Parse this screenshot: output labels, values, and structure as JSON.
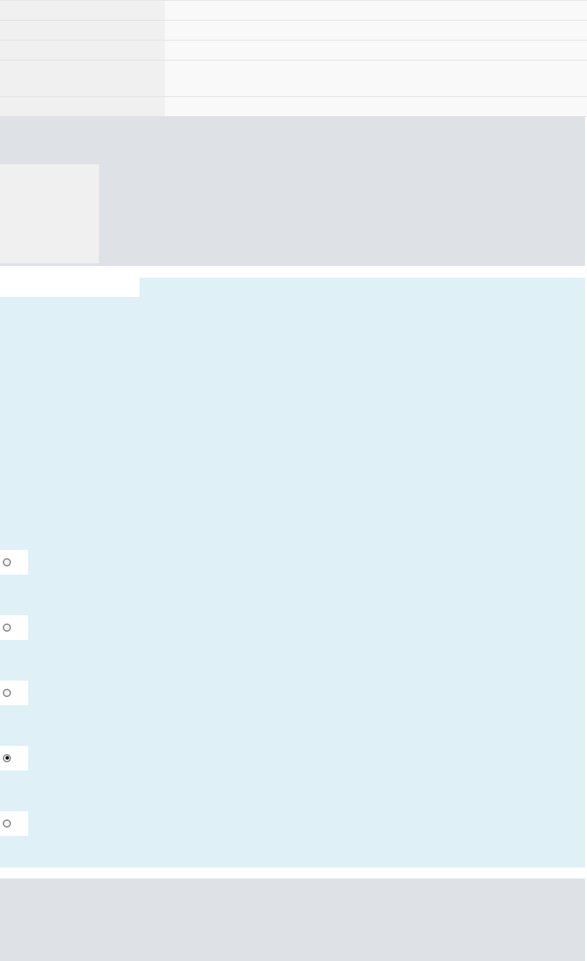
{
  "table": {
    "rows": [
      {
        "kind": "single"
      },
      {
        "kind": "single"
      },
      {
        "kind": "single"
      },
      {
        "kind": "tall"
      },
      {
        "kind": "single"
      }
    ]
  },
  "options": [
    {
      "selected": false
    },
    {
      "selected": false
    },
    {
      "selected": false
    },
    {
      "selected": true
    },
    {
      "selected": false
    }
  ]
}
